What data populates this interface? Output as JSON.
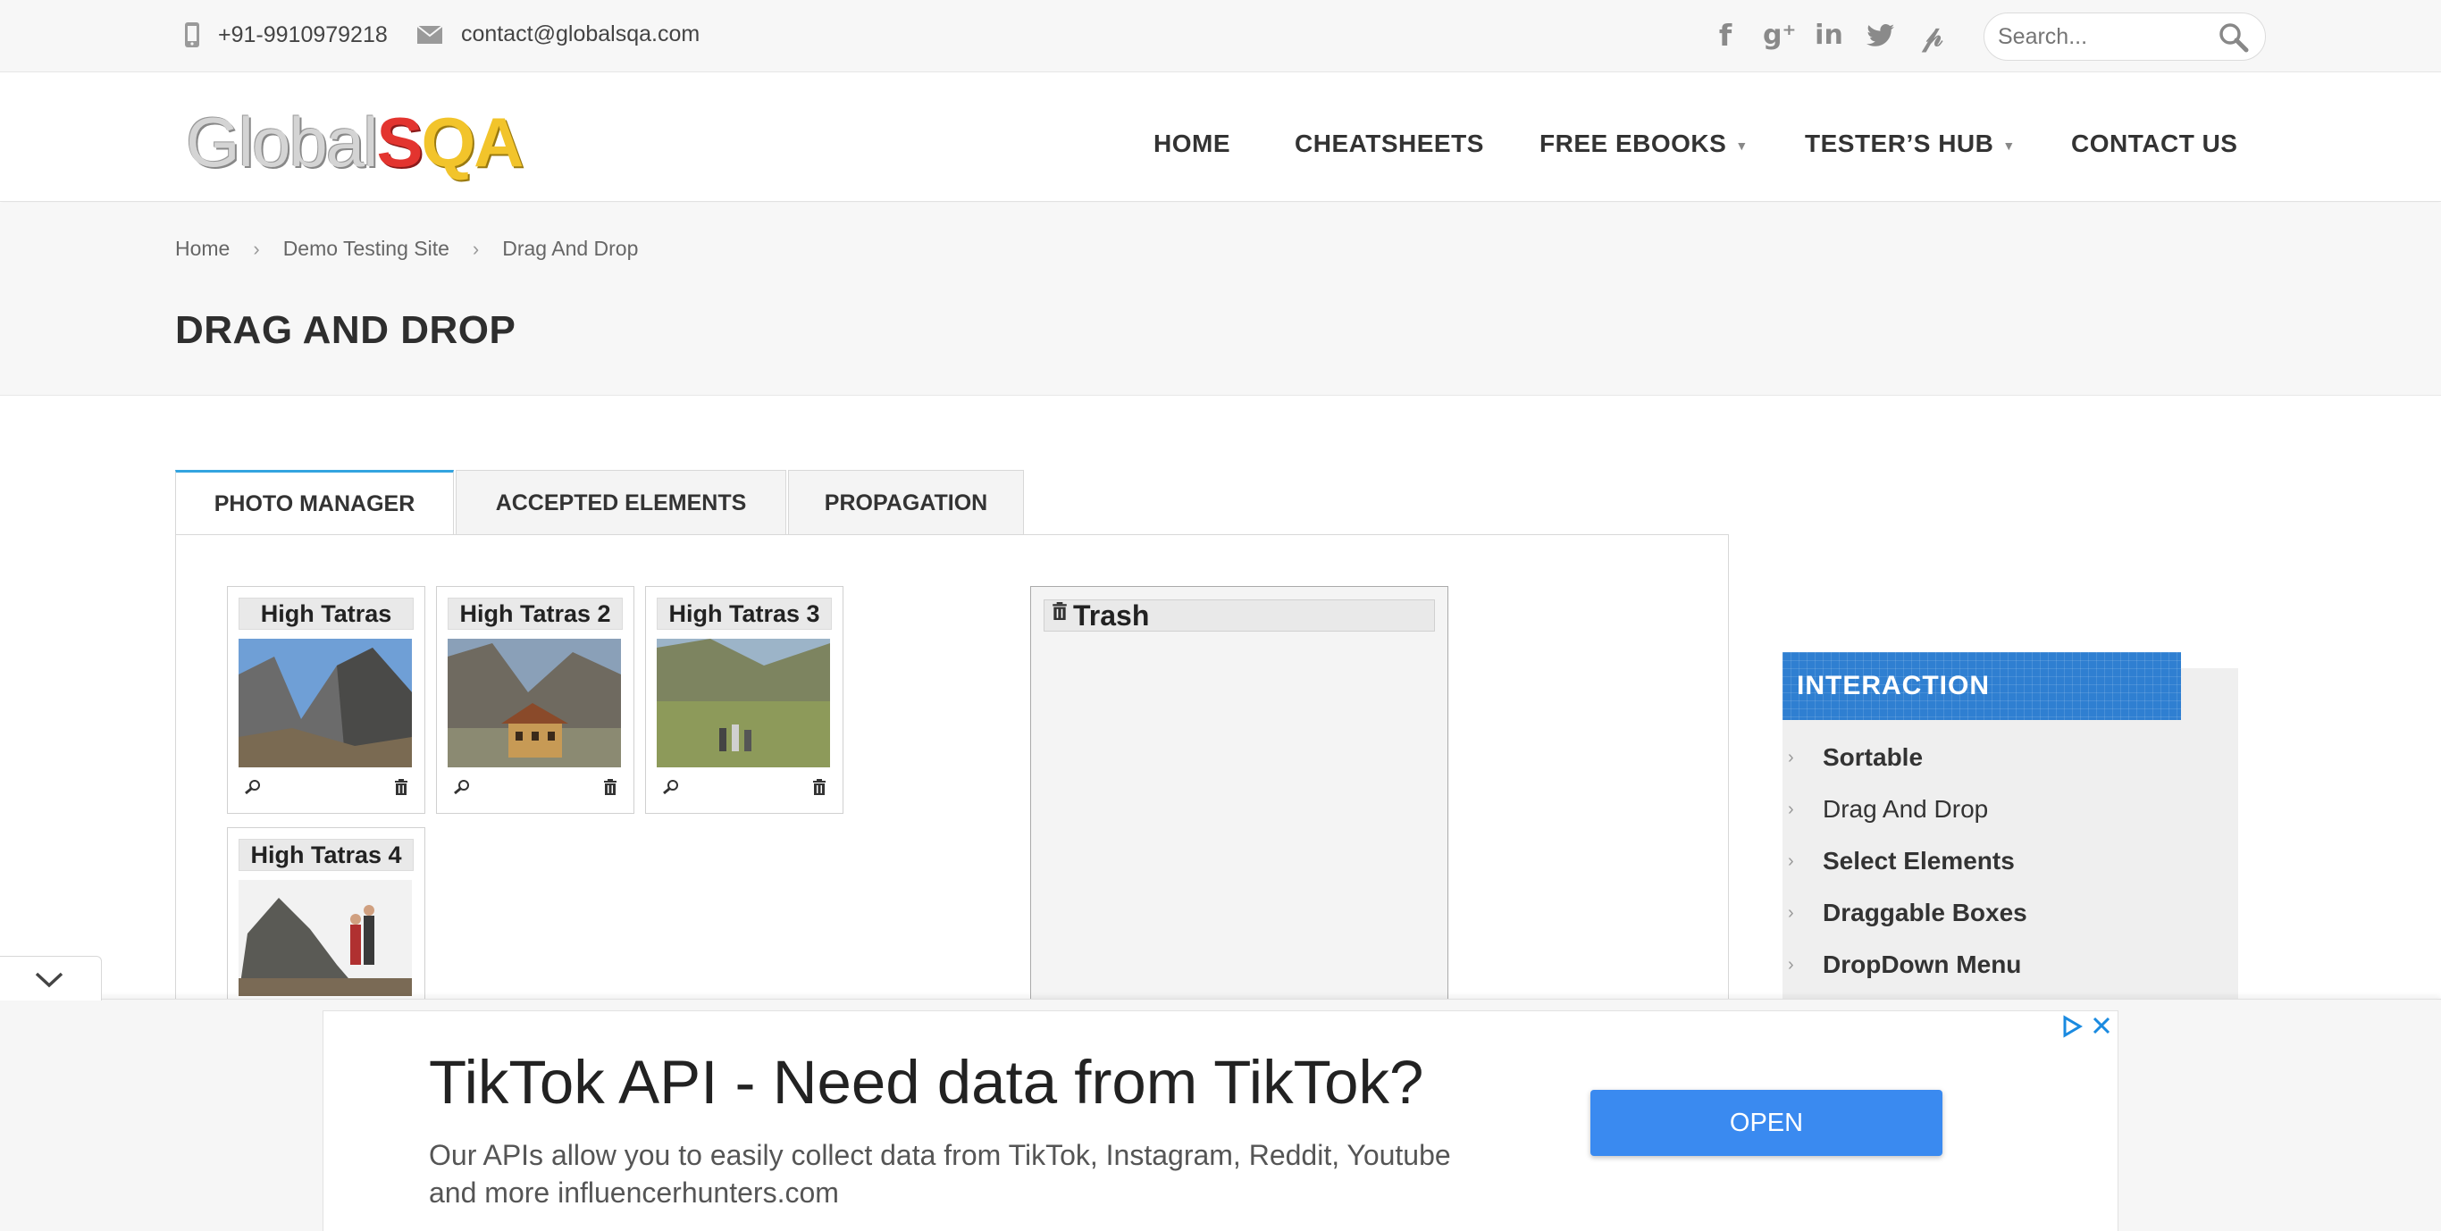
{
  "topbar": {
    "phone": "+91-9910979218",
    "email": "contact@globalsqa.com",
    "search_placeholder": "Search..."
  },
  "social": [
    "facebook-icon",
    "google-plus-icon",
    "linkedin-icon",
    "twitter-icon",
    "pinterest-icon"
  ],
  "logo": {
    "part1": "Global",
    "part2": "S",
    "part3": "QA"
  },
  "nav": {
    "home": "HOME",
    "cheatsheets": "CHEATSHEETS",
    "free_ebooks": "FREE EBOOKS",
    "testers_hub": "TESTER’S HUB",
    "contact": "CONTACT US"
  },
  "breadcrumb": [
    "Home",
    "Demo Testing Site",
    "Drag And Drop"
  ],
  "page_title": "DRAG AND DROP",
  "tabs": [
    "PHOTO MANAGER",
    "ACCEPTED ELEMENTS",
    "PROPAGATION"
  ],
  "gallery": [
    {
      "title": "High Tatras"
    },
    {
      "title": "High Tatras 2"
    },
    {
      "title": "High Tatras 3"
    },
    {
      "title": "High Tatras 4"
    }
  ],
  "trash": {
    "title": "Trash"
  },
  "sidebar": {
    "heading": "INTERACTION",
    "items": [
      "Sortable",
      "Drag And Drop",
      "Select Elements",
      "Draggable Boxes",
      "DropDown Menu"
    ]
  },
  "ad": {
    "headline": "TikTok API - Need data from TikTok?",
    "body": "Our APIs allow you to easily collect data from TikTok, Instagram, Reddit, Youtube and more influencerhunters.com",
    "button": "OPEN"
  },
  "colors": {
    "accent": "#33a4e0",
    "sidebar_head": "#2f7fd1",
    "ad_button": "#3a8af0"
  }
}
